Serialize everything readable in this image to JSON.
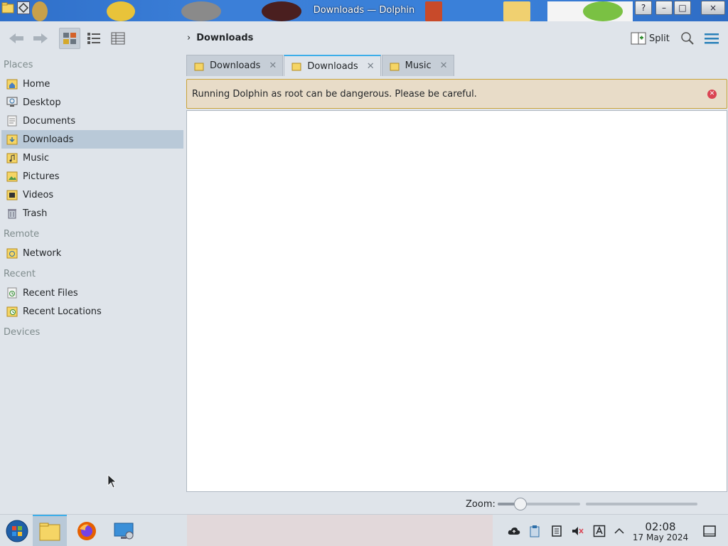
{
  "window": {
    "title": "Downloads — Dolphin"
  },
  "window_buttons": {
    "help": "?",
    "minimize": "–",
    "maximize": "□",
    "close": "×"
  },
  "toolbar": {
    "breadcrumb": "Downloads",
    "split_label": "Split"
  },
  "sidebar": {
    "sections": [
      {
        "header": "Places",
        "items": [
          "Home",
          "Desktop",
          "Documents",
          "Downloads",
          "Music",
          "Pictures",
          "Videos",
          "Trash"
        ]
      },
      {
        "header": "Remote",
        "items": [
          "Network"
        ]
      },
      {
        "header": "Recent",
        "items": [
          "Recent Files",
          "Recent Locations"
        ]
      },
      {
        "header": "Devices",
        "items": []
      }
    ],
    "selected": "Downloads"
  },
  "tabs": [
    {
      "label": "Downloads",
      "active": false
    },
    {
      "label": "Downloads",
      "active": true
    },
    {
      "label": "Music",
      "active": false
    }
  ],
  "warning": {
    "message": "Running Dolphin as root can be dangerous. Please be careful."
  },
  "statusbar": {
    "zoom_label": "Zoom:",
    "zoom_level": 0.28
  },
  "taskbar": {
    "time": "02:08",
    "date": "17 May 2024"
  },
  "colors": {
    "accent": "#3daee9",
    "selection": "#b9c9d8",
    "warning_border": "#c9a33a",
    "close_red": "#da4453"
  }
}
